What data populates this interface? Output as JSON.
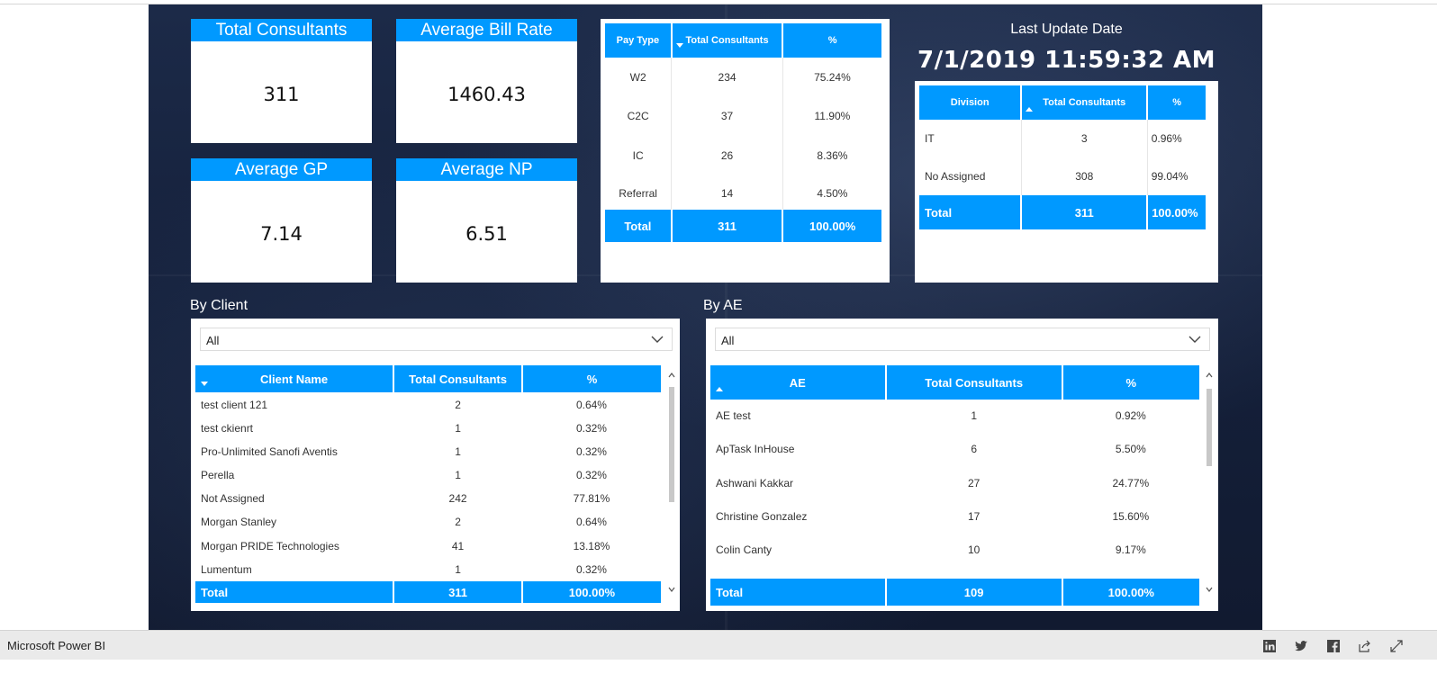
{
  "colors": {
    "accent": "#0099ff",
    "canvas_bg": "#15213c",
    "footer_bg": "#eaeaea"
  },
  "kpis": [
    {
      "title": "Total Consultants",
      "value": "311"
    },
    {
      "title": "Average Bill Rate",
      "value": "1460.43"
    },
    {
      "title": "Average GP",
      "value": "7.14"
    },
    {
      "title": "Average NP",
      "value": "6.51"
    }
  ],
  "pay_type_table": {
    "headers": [
      "Pay Type",
      "Total Consultants",
      "%"
    ],
    "rows": [
      [
        "W2",
        "234",
        "75.24%"
      ],
      [
        "C2C",
        "37",
        "11.90%"
      ],
      [
        "IC",
        "26",
        "8.36%"
      ],
      [
        "Referral",
        "14",
        "4.50%"
      ]
    ],
    "total": [
      "Total",
      "311",
      "100.00%"
    ]
  },
  "last_update": {
    "label": "Last Update Date",
    "value": "7/1/2019 11:59:32 AM"
  },
  "division_table": {
    "headers": [
      "Division",
      "Total Consultants",
      "%"
    ],
    "rows": [
      [
        "IT",
        "3",
        "0.96%"
      ],
      [
        "No Assigned",
        "308",
        "99.04%"
      ]
    ],
    "total": [
      "Total",
      "311",
      "100.00%"
    ]
  },
  "by_client": {
    "title": "By Client",
    "filter_value": "All",
    "headers": [
      "Client Name",
      "Total Consultants",
      "%"
    ],
    "rows": [
      [
        "test client 121",
        "2",
        "0.64%"
      ],
      [
        "test ckienrt",
        "1",
        "0.32%"
      ],
      [
        "Pro-Unlimited Sanofi Aventis",
        "1",
        "0.32%"
      ],
      [
        "Perella",
        "1",
        "0.32%"
      ],
      [
        "Not Assigned",
        "242",
        "77.81%"
      ],
      [
        "Morgan Stanley",
        "2",
        "0.64%"
      ],
      [
        "Morgan PRIDE Technologies",
        "41",
        "13.18%"
      ],
      [
        "Lumentum",
        "1",
        "0.32%"
      ]
    ],
    "total": [
      "Total",
      "311",
      "100.00%"
    ]
  },
  "by_ae": {
    "title": "By AE",
    "filter_value": "All",
    "headers": [
      "AE",
      "Total Consultants",
      "%"
    ],
    "rows": [
      [
        "AE test",
        "1",
        "0.92%"
      ],
      [
        "ApTask InHouse",
        "6",
        "5.50%"
      ],
      [
        "Ashwani Kakkar",
        "27",
        "24.77%"
      ],
      [
        "Christine Gonzalez",
        "17",
        "15.60%"
      ],
      [
        "Colin Canty",
        "10",
        "9.17%"
      ]
    ],
    "total": [
      "Total",
      "109",
      "100.00%"
    ]
  },
  "footer": {
    "brand": "Microsoft Power BI",
    "icons": [
      "linkedin-icon",
      "twitter-icon",
      "facebook-icon",
      "share-icon",
      "fullscreen-icon"
    ]
  }
}
